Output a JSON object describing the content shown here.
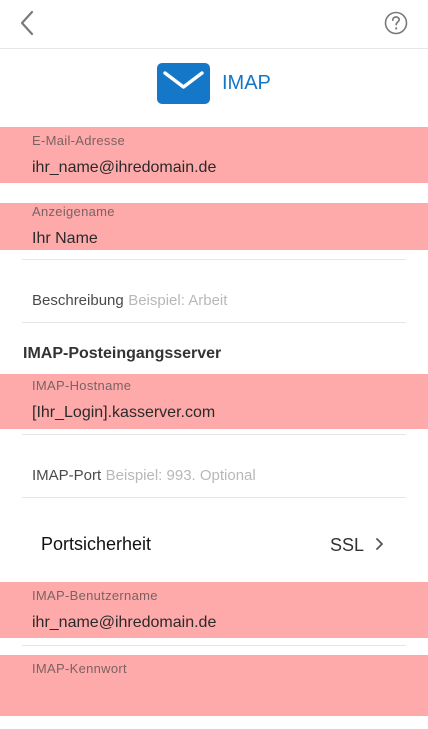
{
  "nav": {
    "back_icon": "chevron-left-icon",
    "help_icon": "question-circle-icon"
  },
  "header": {
    "title": "IMAP",
    "icon": "mail-envelope-icon",
    "accent_color": "#1477c7"
  },
  "highlight_color": "#ffaaaa",
  "fields": {
    "email": {
      "label": "E-Mail-Adresse",
      "value": "ihr_name@ihredomain.de"
    },
    "display_name": {
      "label": "Anzeigename",
      "value": "Ihr Name"
    },
    "description": {
      "label": "Beschreibung",
      "placeholder": "Beispiel: Arbeit"
    },
    "imap_host": {
      "label": "IMAP-Hostname",
      "value": "[Ihr_Login].kasserver.com"
    },
    "imap_port": {
      "label": "IMAP-Port",
      "placeholder": "Beispiel: 993. Optional"
    },
    "imap_user": {
      "label": "IMAP-Benutzername",
      "value": "ihr_name@ihredomain.de"
    },
    "imap_password": {
      "label": "IMAP-Kennwort",
      "value": ""
    }
  },
  "section": {
    "incoming_title": "IMAP-Posteingangsserver"
  },
  "security": {
    "label": "Portsicherheit",
    "value": "SSL"
  }
}
